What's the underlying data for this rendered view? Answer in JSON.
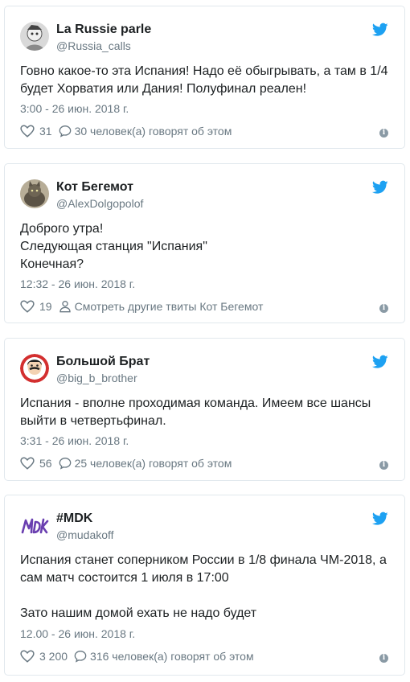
{
  "tweets": [
    {
      "name": "La Russie parle",
      "handle": "@Russia_calls",
      "text": [
        "Говно какое-то эта Испания! Надо её обыгрывать, а там в 1/4 будет Хорватия или Дания! Полуфинал реален!"
      ],
      "time": "3:00 - 26 июн. 2018 г.",
      "likes": "31",
      "action_text": "30 человек(а) говорят об этом",
      "action_icon": "speech-bubble-icon"
    },
    {
      "name": "Кот Бегемот",
      "handle": "@AlexDolgopolof",
      "text": [
        "Доброго утра!",
        "Следующая станция \"Испания\"",
        "Конечная?"
      ],
      "time": "12:32 - 26 июн. 2018 г.",
      "likes": "19",
      "action_text": "Смотреть другие твиты Кот Бегемот",
      "action_icon": "person-icon"
    },
    {
      "name": "Большой Брат",
      "handle": "@big_b_brother",
      "text": [
        "Испания - вполне проходимая команда. Имеем все шансы выйти в четвертьфинал."
      ],
      "time": "3:31 - 26 июн. 2018 г.",
      "likes": "56",
      "action_text": "25 человек(а) говорят об этом",
      "action_icon": "speech-bubble-icon"
    },
    {
      "name": "#MDK",
      "handle": "@mudakoff",
      "text": [
        "Испания станет соперником России в 1/8 финала ЧМ-2018, а сам матч состоится 1 июля в 17:00",
        "",
        "Зато нашим домой ехать не надо будет"
      ],
      "time": "12.00 - 26 июн. 2018 г.",
      "likes": "3 200",
      "action_text": "316 человек(а) говорят об этом",
      "action_icon": "speech-bubble-icon"
    }
  ],
  "info_glyph": "i",
  "colors": {
    "twitter_blue": "#1da1f2",
    "muted": "#697882",
    "border": "#e1e8ed"
  }
}
